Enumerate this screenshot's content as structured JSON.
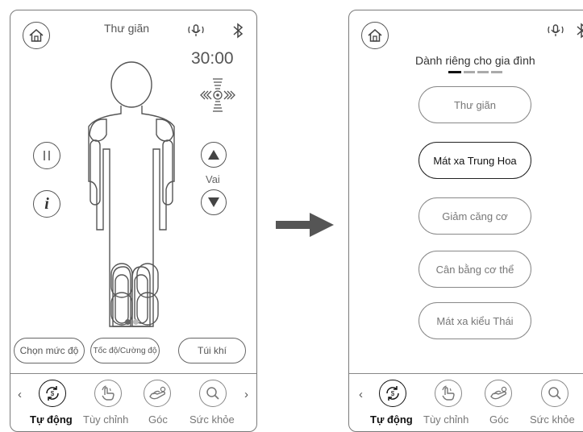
{
  "left_screen": {
    "title": "Thư giãn",
    "timer": "30:00",
    "side_label": "Vai",
    "bottom_buttons": [
      "Chọn mức độ",
      "Tốc độ/Cường độ",
      "Túi khí"
    ],
    "nav_items": [
      {
        "label": "Tự động",
        "icon": "auto-cycle-icon",
        "active": true
      },
      {
        "label": "Tùy chỉnh",
        "icon": "hand-icon",
        "active": false
      },
      {
        "label": "Góc",
        "icon": "recline-icon",
        "active": false
      },
      {
        "label": "Sức khỏe",
        "icon": "search-health-icon",
        "active": false
      }
    ],
    "page_dots": 2,
    "active_dot": 0
  },
  "right_screen": {
    "heading": "Dành riêng cho gia đình",
    "programs": [
      {
        "label": "Thư giãn",
        "selected": false
      },
      {
        "label": "Mát xa Trung Hoa",
        "selected": true
      },
      {
        "label": "Giảm căng cơ",
        "selected": false
      },
      {
        "label": "Cân bằng cơ thể",
        "selected": false
      },
      {
        "label": "Mát xa kiểu Thái",
        "selected": false
      }
    ],
    "nav_items": [
      {
        "label": "Tự động",
        "icon": "auto-cycle-icon",
        "active": true
      },
      {
        "label": "Tùy chỉnh",
        "icon": "hand-icon",
        "active": false
      },
      {
        "label": "Góc",
        "icon": "recline-icon",
        "active": false
      },
      {
        "label": "Sức khỏe",
        "icon": "search-health-icon",
        "active": false
      }
    ]
  },
  "colors": {
    "border": "#7a7a7a",
    "arrow": "#555555",
    "text": "#333333"
  }
}
